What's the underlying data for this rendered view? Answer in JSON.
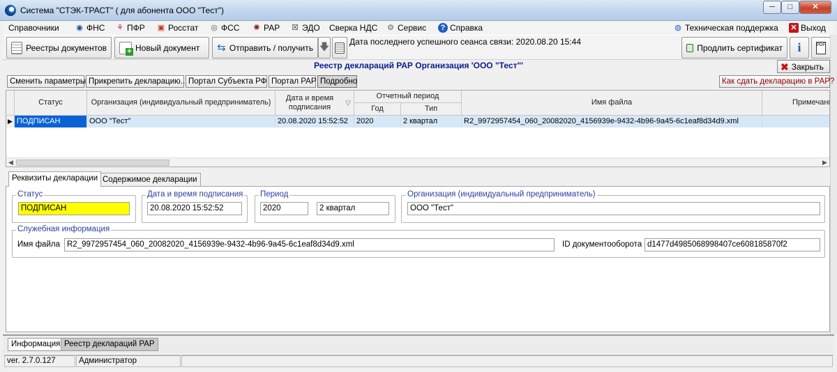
{
  "window": {
    "title": "Система \"СТЭК-ТРАСТ\" ( для абонента ООО \"Тест\")",
    "minimize_glyph": "─",
    "maximize_glyph": "□",
    "close_glyph": "✕"
  },
  "menu": {
    "items": [
      {
        "label": "Справочники",
        "icon": ""
      },
      {
        "label": "ФНС",
        "icon": "fns-icon"
      },
      {
        "label": "ПФР",
        "icon": "pfr-icon"
      },
      {
        "label": "Росстат",
        "icon": "rosstat-icon"
      },
      {
        "label": "ФСС",
        "icon": "fss-icon"
      },
      {
        "label": "РАР",
        "icon": "rar-icon"
      },
      {
        "label": "ЭДО",
        "icon": "edo-icon"
      },
      {
        "label": "Сверка НДС",
        "icon": ""
      },
      {
        "label": "Сервис",
        "icon": "gear-icon"
      },
      {
        "label": "Справка",
        "icon": "help-icon"
      }
    ],
    "support_label": "Техническая поддержка",
    "exit_label": "Выход"
  },
  "toolbar": {
    "registries_label": "Реестры документов",
    "new_doc_label": "Новый документ",
    "send_receive_label": "Отправить / получить",
    "last_session_text": "Дата последнего успешного сеанса связи: 2020.08.20 15:44",
    "extend_cert_label": "Продлить сертификат"
  },
  "registry": {
    "title": "Реестр деклараций РАР  Организация 'ООО \"Тест\"'",
    "close_label": "Закрыть",
    "buttons": {
      "change_params": "Сменить параметры",
      "attach": "Прикрепить декларацию...",
      "portal_subject": "Портал Субъекта РФ",
      "portal_rar": "Портал РАР",
      "details": "Подробно",
      "how_to": "Как сдать декларацию в РАР?"
    }
  },
  "grid": {
    "headers": {
      "status": "Статус",
      "organization": "Организация (индивидуальный предприниматель)",
      "signed_datetime": "Дата и время подписания",
      "sort_glyph": "▽",
      "period": "Отчетный период",
      "year": "Год",
      "type": "Тип",
      "filename": "Имя файла",
      "note": "Примечание"
    },
    "rows": [
      {
        "marker": "▶",
        "status": "ПОДПИСАН",
        "organization": "ООО \"Тест\"",
        "signed_datetime": "20.08.2020 15:52:52",
        "year": "2020",
        "type": "2 квартал",
        "filename": "R2_9972957454_060_20082020_4156939e-9432-4b96-9a45-6c1eaf8d34d9.xml",
        "note": ""
      }
    ]
  },
  "tabs": {
    "details": "Реквизиты декларации",
    "contents": "Содержимое декларации"
  },
  "details": {
    "status_group": "Статус",
    "status_value": "ПОДПИСАН",
    "status_color": "#ffff00",
    "signed_group": "Дата и время подписания",
    "signed_value": "20.08.2020 15:52:52",
    "period_group": "Период",
    "period_year": "2020",
    "period_quarter": "2 квартал",
    "org_group": "Организация (индивидуальный предприниматель)",
    "org_value": "ООО \"Тест\"",
    "service_group": "Служебная информация",
    "filename_label": "Имя файла",
    "filename_value": "R2_9972957454_060_20082020_4156939e-9432-4b96-9a45-6c1eaf8d34d9.xml",
    "docflow_label": "ID документооборота",
    "docflow_value": "d1477d4985068998407ce608185870f2"
  },
  "bottom_tabs": {
    "info": "Информация",
    "registry": "Реестр деклараций РАР"
  },
  "status_bar": {
    "version": "ver. 2.7.0.127",
    "user": "Администратор"
  },
  "colors": {
    "selection": "#0a63d4",
    "title_blue": "#0a1d8c",
    "how_to_red": "#8a0000"
  }
}
